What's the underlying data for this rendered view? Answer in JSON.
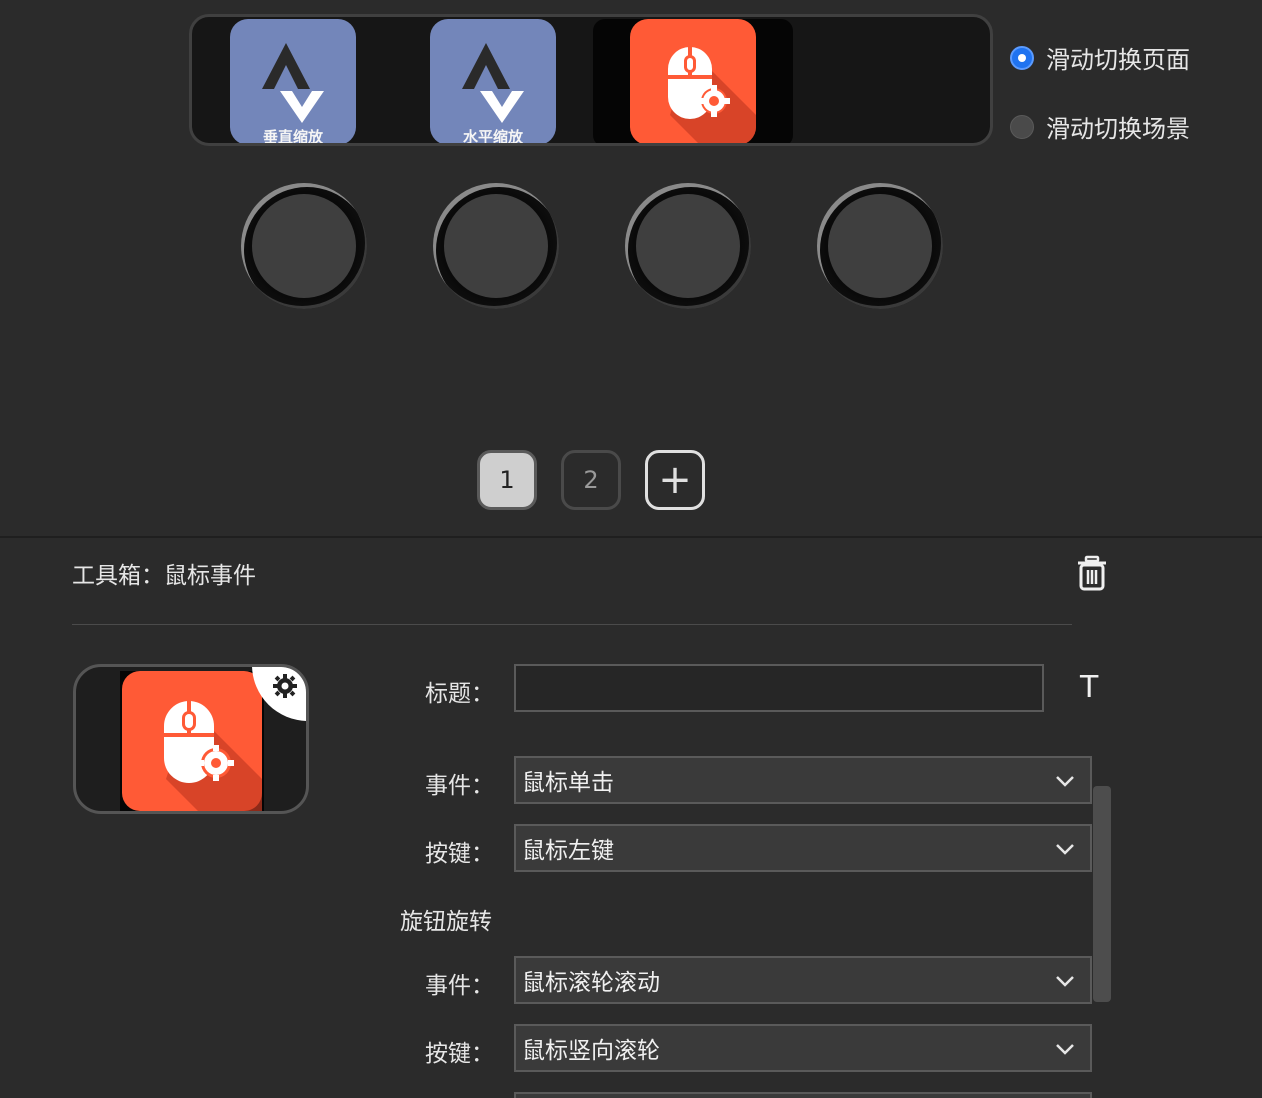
{
  "keys": [
    {
      "caption": "垂直缩放",
      "icon": "scale-vertical-icon"
    },
    {
      "caption": "水平缩放",
      "icon": "scale-horizontal-icon"
    },
    {
      "caption": "",
      "icon": "mouse-settings-icon"
    }
  ],
  "swipe_mode": {
    "options": [
      {
        "label": "滑动切换页面",
        "selected": true
      },
      {
        "label": "滑动切换场景",
        "selected": false
      }
    ]
  },
  "pages": {
    "items": [
      "1",
      "2"
    ],
    "active": "1",
    "add_label": "+"
  },
  "toolbox": {
    "title": "工具箱：鼠标事件",
    "delete_icon": "trash-icon"
  },
  "form": {
    "title_label": "标题：",
    "title_value": "",
    "title_style_icon": "T",
    "event_label": "事件：",
    "event_value": "鼠标单击",
    "key_label": "按键：",
    "key_value": "鼠标左键",
    "knob_section": "旋钮旋转",
    "knob_event_label": "事件：",
    "knob_event_value": "鼠标滚轮滚动",
    "knob_key_label": "按键：",
    "knob_key_value": "鼠标竖向滚轮"
  },
  "colors": {
    "tile_blue": "#7386ba",
    "tile_orange": "#ff5a36",
    "radio_accent": "#1f73f0",
    "background": "#2b2b2b"
  }
}
